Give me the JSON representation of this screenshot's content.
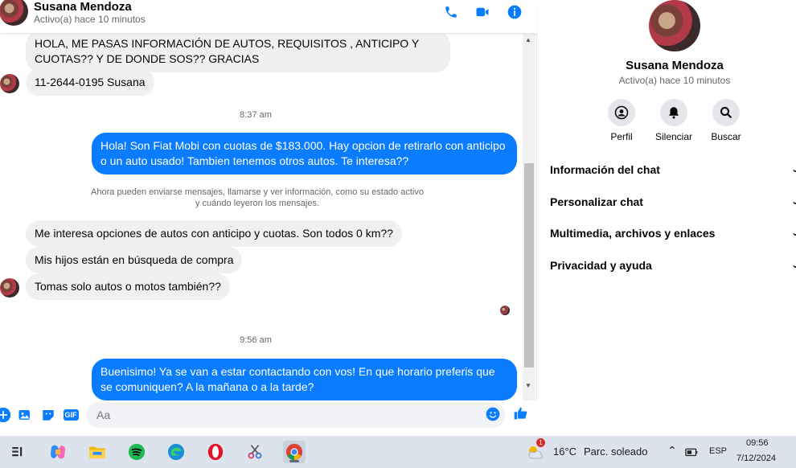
{
  "chat_header": {
    "name": "Susana Mendoza",
    "status": "Activo(a) hace 10 minutos",
    "icons": [
      "phone-icon",
      "video-icon",
      "info-icon"
    ]
  },
  "messages": {
    "m1": "HOLA, ME PASAS INFORMACIÓN DE AUTOS, REQUISITOS , ANTICIPO Y CUOTAS?? Y DE DONDE SOS?? GRACIAS",
    "m2": "11-2644-0195 Susana",
    "time1": "8:37 am",
    "m3": "Hola! Son Fiat Mobi con cuotas de $183.000. Hay opcion de retirarlo con anticipo o un auto usado! Tambien tenemos otros autos. Te interesa??",
    "system_line1": "Ahora pueden enviarse mensajes, llamarse y ver información, como su estado activo",
    "system_line2": "y cuándo leyeron los mensajes.",
    "m4": "Me interesa opciones de autos con anticipo y cuotas. Son todos 0 km??",
    "m5": "Mis hijos están en búsqueda de compra",
    "m6": "Tomas solo autos o motos también??",
    "time2": "9:56 am",
    "m7": "Buenisimo! Ya se van a estar contactando con vos! En que horario preferis que se comuniquen? A la mañana o a la tarde?"
  },
  "composer": {
    "placeholder": "Aa",
    "icons": [
      "plus-icon",
      "image-icon",
      "sticker-icon",
      "gif-icon",
      "emoji-icon",
      "like-icon"
    ],
    "gif_label": "GIF"
  },
  "side_panel": {
    "name": "Susana Mendoza",
    "status": "Activo(a) hace 10 minutos",
    "actions": [
      {
        "label": "Perfil",
        "icon": "profile-icon"
      },
      {
        "label": "Silenciar",
        "icon": "bell-icon"
      },
      {
        "label": "Buscar",
        "icon": "search-icon"
      }
    ],
    "sections": [
      "Información del chat",
      "Personalizar chat",
      "Multimedia, archivos y enlaces",
      "Privacidad y ayuda"
    ]
  },
  "taskbar": {
    "apps": [
      "task-view-icon",
      "copilot-icon",
      "file-explorer-icon",
      "spotify-icon",
      "edge-icon",
      "opera-icon",
      "snipping-tool-icon",
      "chrome-icon"
    ],
    "weather_temp": "16°C",
    "weather_desc": "Parc. soleado",
    "weather_badge": "1",
    "language": "ESP",
    "clock_time": "09:56",
    "clock_date": "7/12/2024"
  },
  "colors": {
    "accent": "#0a7cff",
    "incoming_bubble": "#f0f0f0",
    "taskbar": "#dde3ec"
  }
}
